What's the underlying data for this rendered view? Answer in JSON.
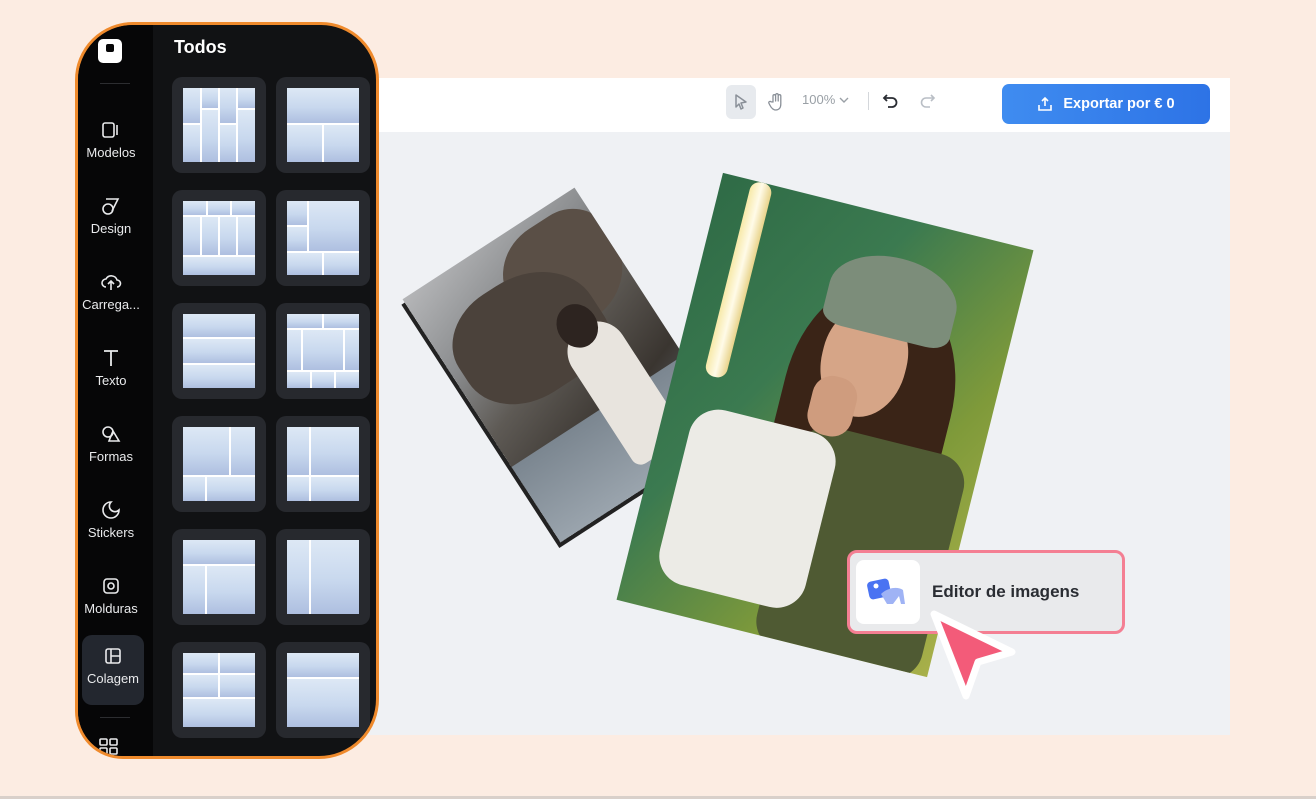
{
  "sidebar": {
    "section_title": "Todos",
    "items": [
      {
        "label": "Modelos",
        "icon": "templates-icon"
      },
      {
        "label": "Design",
        "icon": "design-icon"
      },
      {
        "label": "Carrega...",
        "icon": "upload-cloud-icon"
      },
      {
        "label": "Texto",
        "icon": "text-icon"
      },
      {
        "label": "Formas",
        "icon": "shapes-icon"
      },
      {
        "label": "Stickers",
        "icon": "stickers-icon"
      },
      {
        "label": "Molduras",
        "icon": "frames-icon"
      },
      {
        "label": "Colagem",
        "icon": "collage-icon",
        "active": true
      }
    ]
  },
  "toolbar": {
    "zoom": "100%",
    "export_label": "Exportar por € 0"
  },
  "chip": {
    "label": "Editor de imagens"
  },
  "colors": {
    "background": "#fcece2",
    "accent_orange": "#ef8a2c",
    "export_blue": "#3a82ee",
    "chip_border": "#f47f93"
  }
}
